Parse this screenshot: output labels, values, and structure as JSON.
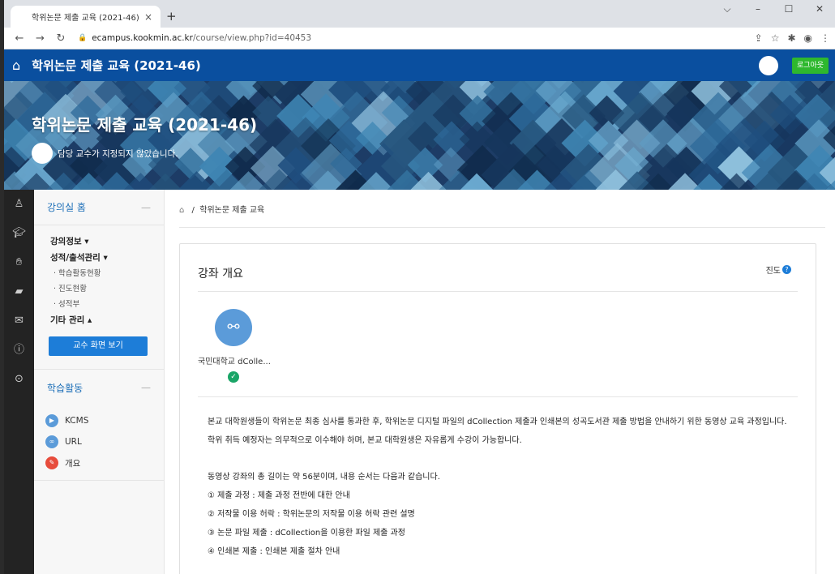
{
  "browser": {
    "tab_title": "학위논문 제출 교육 (2021-46)",
    "tab_close": "×",
    "new_tab": "+",
    "url_host": "ecampus.kookmin.ac.kr",
    "url_path": "/course/view.php?id=40453"
  },
  "site": {
    "title": "학위논문 제출 교육 (2021-46)",
    "logout_label": "로그아웃"
  },
  "banner": {
    "title": "학위논문 제출 교육 (2021-46)",
    "professor": "담당 교수가 지정되지 않았습니다."
  },
  "sidebar": {
    "home_label": "강의실 홈",
    "course_info": "강의정보 ▾",
    "grade_attendance": "성적/출석관리 ▾",
    "sub_items": [
      "· 학습활동현황",
      "· 진도현황",
      "· 성적부"
    ],
    "other_manage": "기타 관리 ▴",
    "prof_view_button": "교수 화면 보기",
    "activities_label": "학습활동",
    "activities": [
      {
        "label": "KCMS",
        "color": "#5b9bd9"
      },
      {
        "label": "URL",
        "color": "#5b9bd9"
      },
      {
        "label": "개요",
        "color": "#e74c3c"
      }
    ]
  },
  "breadcrumb": {
    "separator": "/",
    "course": "학위논문 제출 교육"
  },
  "course": {
    "section_title": "강좌 개요",
    "progress_label": "진도",
    "module_label": "국민대학교 dColle...",
    "description": [
      "본교 대학원생들이 학위논문 최종 심사를 통과한 후, 학위논문 디지털 파일의 dCollection 제출과 인쇄본의 성곡도서관 제출 방법을 안내하기 위한 동영상 교육 과정입니다.",
      "학위 취득 예정자는 의무적으로 이수해야 하며, 본교 대학원생은 자유롭게 수강이 가능합니다.",
      "동영상 강좌의 총 길이는 약 56분이며, 내용 순서는 다음과 같습니다.",
      "① 제출 과정 : 제출 과정 전반에 대한 안내",
      "② 저작물 이용 허락 : 학위논문의 저작물 이용 허락 관련 설명",
      "③ 논문 파일 제출 : dCollection을 이용한 파일 제출 과정",
      "④ 인쇄본 제출 : 인쇄본 제출 절차 안내"
    ]
  },
  "colors": {
    "header_blue": "#0a4f9f",
    "link_blue": "#1d6fb8",
    "logout_green": "#2eb82e",
    "button_blue": "#1d7dd8",
    "check_green": "#1aa567"
  }
}
